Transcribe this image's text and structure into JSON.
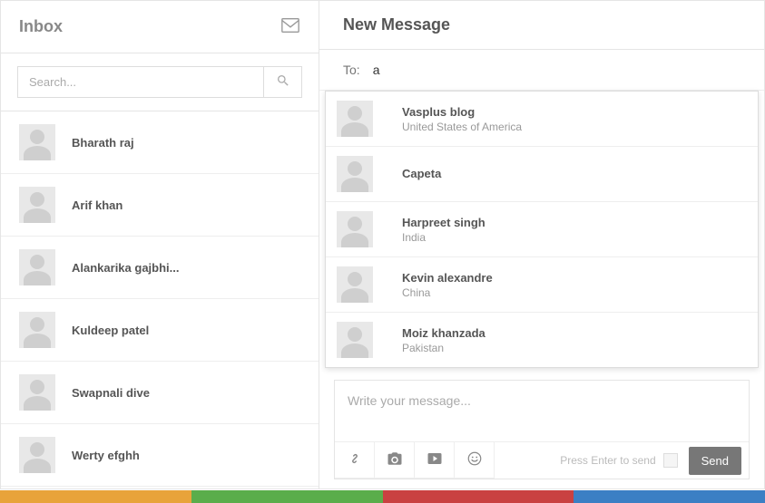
{
  "sidebar": {
    "title": "Inbox",
    "search_placeholder": "Search...",
    "conversations": [
      {
        "name": "Bharath raj"
      },
      {
        "name": "Arif khan"
      },
      {
        "name": "Alankarika gajbhi..."
      },
      {
        "name": "Kuldeep patel"
      },
      {
        "name": "Swapnali dive"
      },
      {
        "name": "Werty efghh"
      }
    ]
  },
  "main": {
    "title": "New Message",
    "to_label": "To:",
    "to_value": "a",
    "suggestions": [
      {
        "name": "Vasplus blog",
        "sub": "United States of America"
      },
      {
        "name": "Capeta",
        "sub": ""
      },
      {
        "name": "Harpreet singh",
        "sub": "India"
      },
      {
        "name": "Kevin alexandre",
        "sub": "China"
      },
      {
        "name": "Moiz khanzada",
        "sub": "Pakistan"
      }
    ],
    "composer_placeholder": "Write your message...",
    "enter_hint": "Press Enter to send",
    "send_label": "Send"
  }
}
